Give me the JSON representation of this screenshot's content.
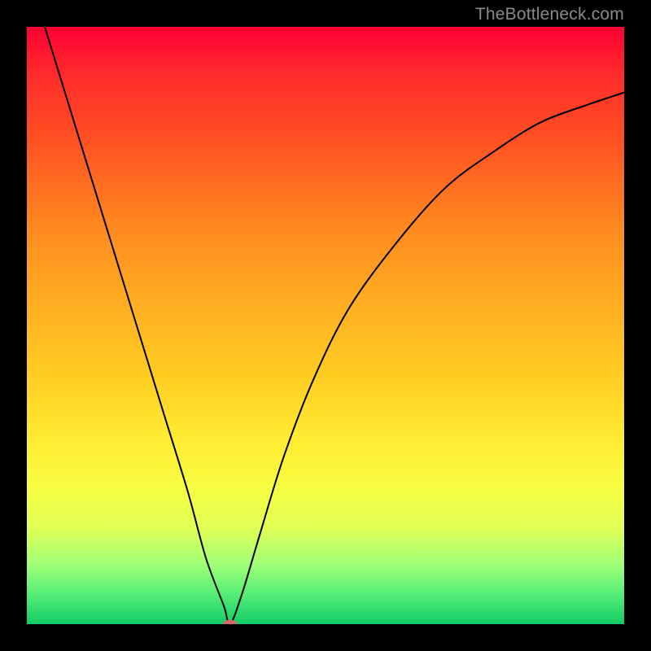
{
  "watermark": "TheBottleneck.com",
  "chart_data": {
    "type": "line",
    "title": "",
    "xlabel": "",
    "ylabel": "",
    "xlim": [
      0,
      100
    ],
    "ylim": [
      0,
      100
    ],
    "background_gradient": [
      "#ff0033",
      "#ffee33",
      "#11cc66"
    ],
    "series": [
      {
        "name": "bottleneck-curve",
        "x": [
          3,
          7,
          11,
          15,
          19,
          23,
          27,
          30,
          33,
          34,
          36,
          39,
          43,
          48,
          54,
          62,
          70,
          78,
          86,
          94,
          100
        ],
        "y": [
          100,
          87,
          74,
          61,
          48,
          35,
          22,
          11,
          3,
          0,
          5,
          15,
          28,
          41,
          53,
          64,
          73,
          79,
          84,
          87,
          89
        ]
      }
    ],
    "marker": {
      "x": 34,
      "y": 0,
      "color": "#d46a6a"
    }
  }
}
